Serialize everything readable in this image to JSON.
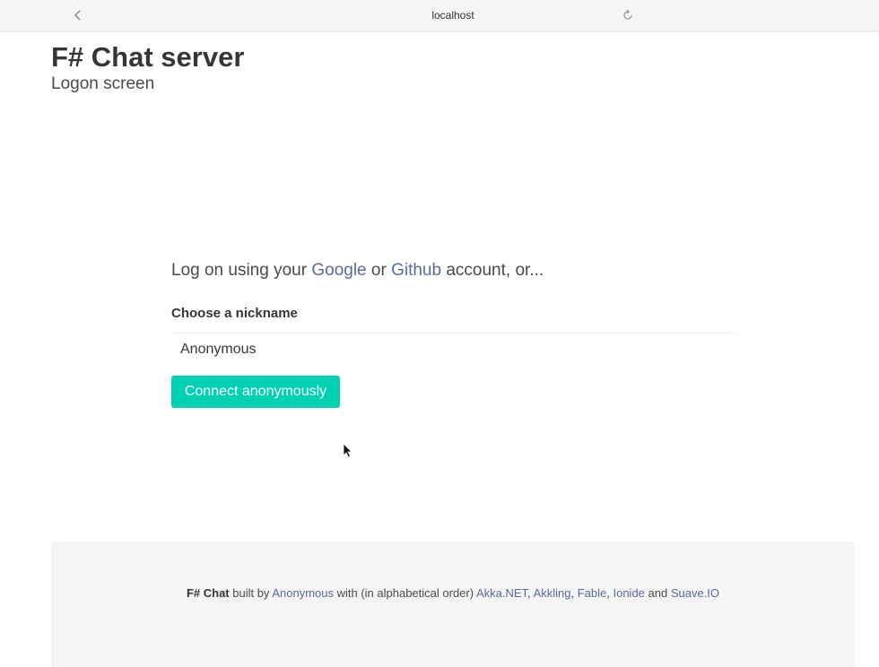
{
  "browser": {
    "url": "localhost",
    "back_icon": "chevron-left-icon",
    "reload_icon": "reload-icon"
  },
  "header": {
    "title": "F# Chat server",
    "subtitle": "Logon screen"
  },
  "logon": {
    "prefix": "Log on using your ",
    "google": "Google",
    "or": " or ",
    "github": "Github",
    "suffix": " account, or..."
  },
  "nickname": {
    "label": "Choose a nickname",
    "value": "Anonymous"
  },
  "connect_button": {
    "label": "Connect anonymously",
    "color": "#00d1b2"
  },
  "footer": {
    "brand": "F# Chat",
    "built_by": " built by ",
    "author": "Anonymous",
    "with": " with (in alphabetical order) ",
    "akka": "Akka.NET",
    "sep1": ", ",
    "akkling": "Akkling",
    "sep2": ", ",
    "fable": "Fable",
    "sep3": ", ",
    "ionide": "Ionide",
    "and": " and ",
    "suave": "Suave.IO"
  },
  "colors": {
    "link": "#5a6a9a",
    "accent": "#00d1b2"
  }
}
